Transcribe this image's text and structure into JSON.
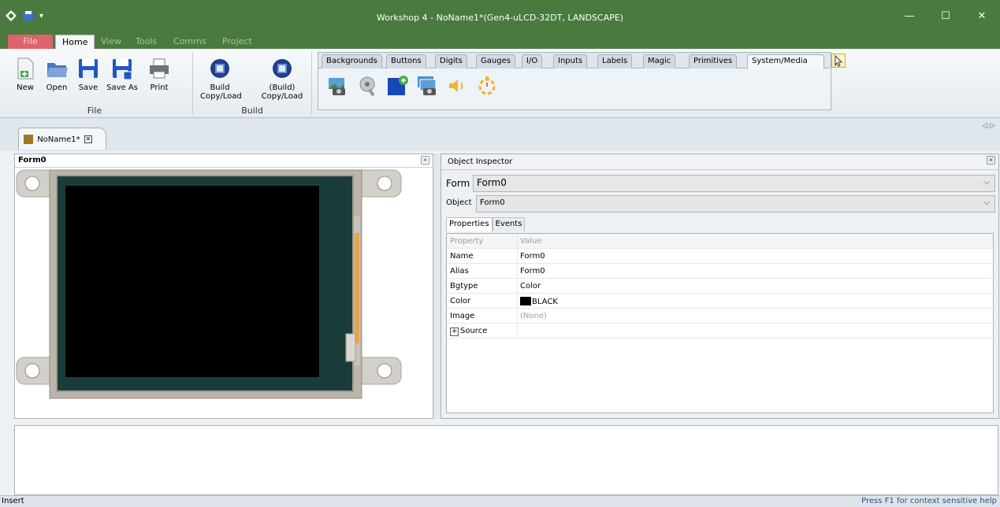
{
  "window": {
    "title": "Workshop 4 - NoName1*(Gen4-uLCD-32DT, LANDSCAPE)",
    "controls": {
      "minimize": "—",
      "maximize": "☐",
      "close": "✕"
    }
  },
  "ribbon_tabs": [
    "File",
    "Home",
    "View",
    "Tools",
    "Comms",
    "Project"
  ],
  "file_group": {
    "label": "File",
    "buttons": [
      "New",
      "Open",
      "Save",
      "Save As",
      "Print"
    ]
  },
  "build_group": {
    "label": "Build",
    "build_line1": "Build",
    "build_line2": "Copy/Load",
    "build2_line1": "(Build)",
    "build2_line2": "Copy/Load"
  },
  "palette_tabs": [
    "Backgrounds",
    "Buttons",
    "Digits",
    "Gauges",
    "I/O",
    "Inputs",
    "Labels",
    "Magic",
    "Primitives",
    "System/Media"
  ],
  "palette_icons": [
    "image-icon",
    "video-icon",
    "user-image-icon",
    "images-icon",
    "sound-icon",
    "timer-icon"
  ],
  "document_tab": "NoName1*",
  "form_panel": {
    "title": "Form0"
  },
  "inspector": {
    "title": "Object Inspector",
    "form_label": "Form",
    "form_value": "Form0",
    "object_label": "Object",
    "object_value": "Form0",
    "tabs": [
      "Properties",
      "Events"
    ],
    "columns": [
      "Property",
      "Value"
    ],
    "rows": [
      {
        "property": "Name",
        "value": "Form0"
      },
      {
        "property": "Alias",
        "value": "Form0"
      },
      {
        "property": "Bgtype",
        "value": "Color"
      },
      {
        "property": "Color",
        "value": "BLACK"
      },
      {
        "property": "Image",
        "value": "(None)"
      },
      {
        "property": "Source",
        "value": ""
      }
    ]
  },
  "status": {
    "left": "Insert",
    "right": "Press F1 for context sensitive help"
  },
  "colors": {
    "titlebar": "#4a7a3d",
    "file_tab": "#e0626a",
    "screen": "#000000"
  }
}
